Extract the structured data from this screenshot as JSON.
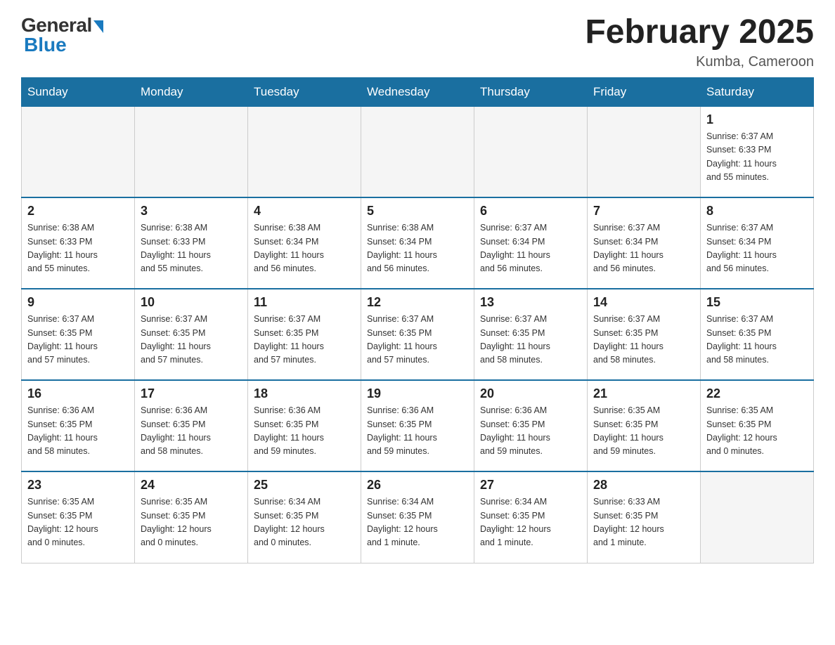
{
  "logo": {
    "general": "General",
    "blue": "Blue"
  },
  "title": "February 2025",
  "location": "Kumba, Cameroon",
  "days_of_week": [
    "Sunday",
    "Monday",
    "Tuesday",
    "Wednesday",
    "Thursday",
    "Friday",
    "Saturday"
  ],
  "weeks": [
    [
      {
        "day": "",
        "info": ""
      },
      {
        "day": "",
        "info": ""
      },
      {
        "day": "",
        "info": ""
      },
      {
        "day": "",
        "info": ""
      },
      {
        "day": "",
        "info": ""
      },
      {
        "day": "",
        "info": ""
      },
      {
        "day": "1",
        "info": "Sunrise: 6:37 AM\nSunset: 6:33 PM\nDaylight: 11 hours\nand 55 minutes."
      }
    ],
    [
      {
        "day": "2",
        "info": "Sunrise: 6:38 AM\nSunset: 6:33 PM\nDaylight: 11 hours\nand 55 minutes."
      },
      {
        "day": "3",
        "info": "Sunrise: 6:38 AM\nSunset: 6:33 PM\nDaylight: 11 hours\nand 55 minutes."
      },
      {
        "day": "4",
        "info": "Sunrise: 6:38 AM\nSunset: 6:34 PM\nDaylight: 11 hours\nand 56 minutes."
      },
      {
        "day": "5",
        "info": "Sunrise: 6:38 AM\nSunset: 6:34 PM\nDaylight: 11 hours\nand 56 minutes."
      },
      {
        "day": "6",
        "info": "Sunrise: 6:37 AM\nSunset: 6:34 PM\nDaylight: 11 hours\nand 56 minutes."
      },
      {
        "day": "7",
        "info": "Sunrise: 6:37 AM\nSunset: 6:34 PM\nDaylight: 11 hours\nand 56 minutes."
      },
      {
        "day": "8",
        "info": "Sunrise: 6:37 AM\nSunset: 6:34 PM\nDaylight: 11 hours\nand 56 minutes."
      }
    ],
    [
      {
        "day": "9",
        "info": "Sunrise: 6:37 AM\nSunset: 6:35 PM\nDaylight: 11 hours\nand 57 minutes."
      },
      {
        "day": "10",
        "info": "Sunrise: 6:37 AM\nSunset: 6:35 PM\nDaylight: 11 hours\nand 57 minutes."
      },
      {
        "day": "11",
        "info": "Sunrise: 6:37 AM\nSunset: 6:35 PM\nDaylight: 11 hours\nand 57 minutes."
      },
      {
        "day": "12",
        "info": "Sunrise: 6:37 AM\nSunset: 6:35 PM\nDaylight: 11 hours\nand 57 minutes."
      },
      {
        "day": "13",
        "info": "Sunrise: 6:37 AM\nSunset: 6:35 PM\nDaylight: 11 hours\nand 58 minutes."
      },
      {
        "day": "14",
        "info": "Sunrise: 6:37 AM\nSunset: 6:35 PM\nDaylight: 11 hours\nand 58 minutes."
      },
      {
        "day": "15",
        "info": "Sunrise: 6:37 AM\nSunset: 6:35 PM\nDaylight: 11 hours\nand 58 minutes."
      }
    ],
    [
      {
        "day": "16",
        "info": "Sunrise: 6:36 AM\nSunset: 6:35 PM\nDaylight: 11 hours\nand 58 minutes."
      },
      {
        "day": "17",
        "info": "Sunrise: 6:36 AM\nSunset: 6:35 PM\nDaylight: 11 hours\nand 58 minutes."
      },
      {
        "day": "18",
        "info": "Sunrise: 6:36 AM\nSunset: 6:35 PM\nDaylight: 11 hours\nand 59 minutes."
      },
      {
        "day": "19",
        "info": "Sunrise: 6:36 AM\nSunset: 6:35 PM\nDaylight: 11 hours\nand 59 minutes."
      },
      {
        "day": "20",
        "info": "Sunrise: 6:36 AM\nSunset: 6:35 PM\nDaylight: 11 hours\nand 59 minutes."
      },
      {
        "day": "21",
        "info": "Sunrise: 6:35 AM\nSunset: 6:35 PM\nDaylight: 11 hours\nand 59 minutes."
      },
      {
        "day": "22",
        "info": "Sunrise: 6:35 AM\nSunset: 6:35 PM\nDaylight: 12 hours\nand 0 minutes."
      }
    ],
    [
      {
        "day": "23",
        "info": "Sunrise: 6:35 AM\nSunset: 6:35 PM\nDaylight: 12 hours\nand 0 minutes."
      },
      {
        "day": "24",
        "info": "Sunrise: 6:35 AM\nSunset: 6:35 PM\nDaylight: 12 hours\nand 0 minutes."
      },
      {
        "day": "25",
        "info": "Sunrise: 6:34 AM\nSunset: 6:35 PM\nDaylight: 12 hours\nand 0 minutes."
      },
      {
        "day": "26",
        "info": "Sunrise: 6:34 AM\nSunset: 6:35 PM\nDaylight: 12 hours\nand 1 minute."
      },
      {
        "day": "27",
        "info": "Sunrise: 6:34 AM\nSunset: 6:35 PM\nDaylight: 12 hours\nand 1 minute."
      },
      {
        "day": "28",
        "info": "Sunrise: 6:33 AM\nSunset: 6:35 PM\nDaylight: 12 hours\nand 1 minute."
      },
      {
        "day": "",
        "info": ""
      }
    ]
  ]
}
